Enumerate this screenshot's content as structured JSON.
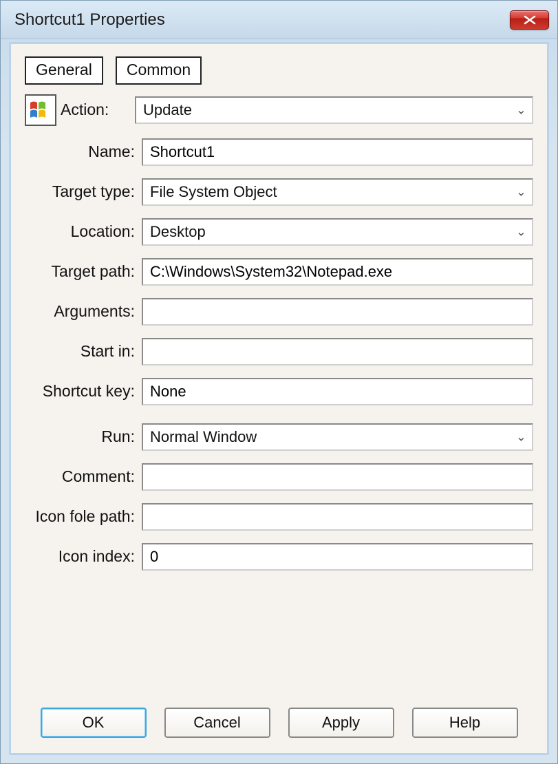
{
  "window": {
    "title": "Shortcut1 Properties"
  },
  "tabs": {
    "general": "General",
    "common": "Common"
  },
  "form": {
    "action": {
      "label": "Action:",
      "value": "Update"
    },
    "name": {
      "label": "Name:",
      "value": "Shortcut1"
    },
    "target_type": {
      "label": "Target type:",
      "value": "File System Object"
    },
    "location": {
      "label": "Location:",
      "value": "Desktop"
    },
    "target_path": {
      "label": "Target path:",
      "value": "C:\\Windows\\System32\\Notepad.exe"
    },
    "arguments": {
      "label": "Arguments:",
      "value": ""
    },
    "start_in": {
      "label": "Start in:",
      "value": ""
    },
    "shortcut_key": {
      "label": "Shortcut key:",
      "value": "None"
    },
    "run": {
      "label": "Run:",
      "value": "Normal Window"
    },
    "comment": {
      "label": "Comment:",
      "value": ""
    },
    "icon_path": {
      "label": "Icon fole path:",
      "value": ""
    },
    "icon_index": {
      "label": "Icon index:",
      "value": "0"
    }
  },
  "buttons": {
    "ok": "OK",
    "cancel": "Cancel",
    "apply": "Apply",
    "help": "Help"
  },
  "icons": {
    "close": "close-icon",
    "logo": "windows-logo-icon"
  }
}
